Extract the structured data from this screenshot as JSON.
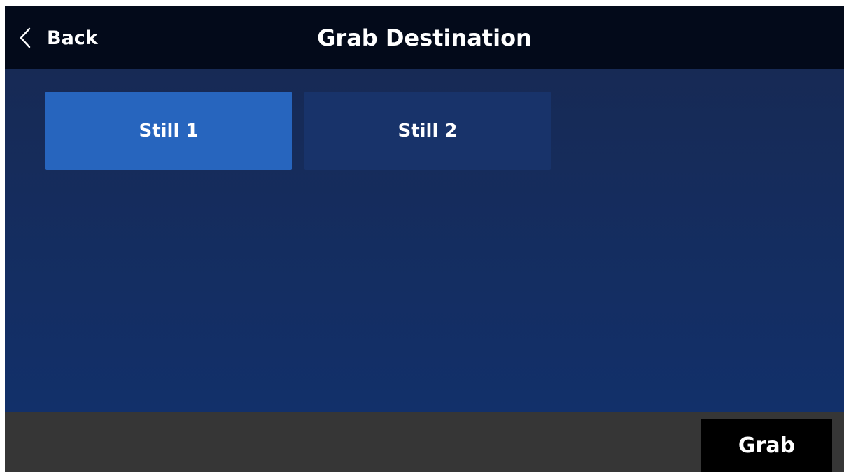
{
  "header": {
    "back_label": "Back",
    "back_icon": "chevron-left-icon",
    "title": "Grab Destination"
  },
  "destinations": [
    {
      "label": "Still 1",
      "selected": true
    },
    {
      "label": "Still 2",
      "selected": false
    }
  ],
  "footer": {
    "grab_label": "Grab"
  },
  "colors": {
    "header_bg": "#030a1a",
    "content_bg": "#14306a",
    "selected_button": "#2765be",
    "unselected_button": "#18336a",
    "footer_bg": "#363636",
    "grab_button_bg": "#000000",
    "text": "#ffffff"
  }
}
